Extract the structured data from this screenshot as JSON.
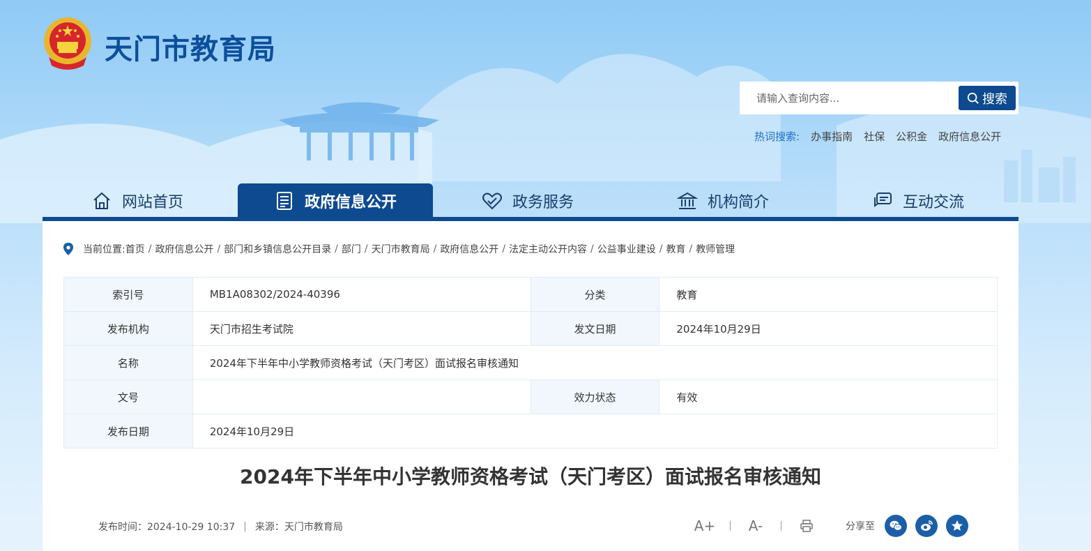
{
  "header": {
    "site_title": "天门市教育局",
    "search_placeholder": "请输入查询内容...",
    "search_button": "搜索",
    "hot_label": "热词搜索:",
    "hot_links": [
      "办事指南",
      "社保",
      "公积金",
      "政府信息公开"
    ]
  },
  "nav": {
    "items": [
      {
        "label": "网站首页",
        "icon": "home-icon",
        "active": false
      },
      {
        "label": "政府信息公开",
        "icon": "document-list-icon",
        "active": true
      },
      {
        "label": "政务服务",
        "icon": "heart-hands-icon",
        "active": false
      },
      {
        "label": "机构简介",
        "icon": "institution-icon",
        "active": false
      },
      {
        "label": "互动交流",
        "icon": "chat-icon",
        "active": false
      }
    ]
  },
  "breadcrumb": {
    "label": "当前位置:",
    "items": [
      "首页",
      "政府信息公开",
      "部门和乡镇信息公开目录",
      "部门",
      "天门市教育局",
      "政府信息公开",
      "法定主动公开内容",
      "公益事业建设",
      "教育",
      "教师管理"
    ]
  },
  "meta": {
    "index_label": "索引号",
    "index_value": "MB1A08302/2024-40396",
    "category_label": "分类",
    "category_value": "教育",
    "publisher_label": "发布机构",
    "publisher_value": "天门市招生考试院",
    "issue_date_label": "发文日期",
    "issue_date_value": "2024年10月29日",
    "name_label": "名称",
    "name_value": "2024年下半年中小学教师资格考试（天门考区）面试报名审核通知",
    "doc_no_label": "文号",
    "doc_no_value": "",
    "status_label": "效力状态",
    "status_value": "有效",
    "pub_date_label": "发布日期",
    "pub_date_value": "2024年10月29日"
  },
  "article": {
    "title": "2024年下半年中小学教师资格考试（天门考区）面试报名审核通知",
    "publish_time": "发布时间：2024-10-29 10:37",
    "source": "来源：天门市教育局"
  },
  "tools": {
    "font_larger": "A+",
    "font_smaller": "A-",
    "share_label": "分享至"
  },
  "colors": {
    "brand": "#0d4a8f",
    "title": "#0d4e9c",
    "table_label_bg": "#f1f7fd"
  }
}
